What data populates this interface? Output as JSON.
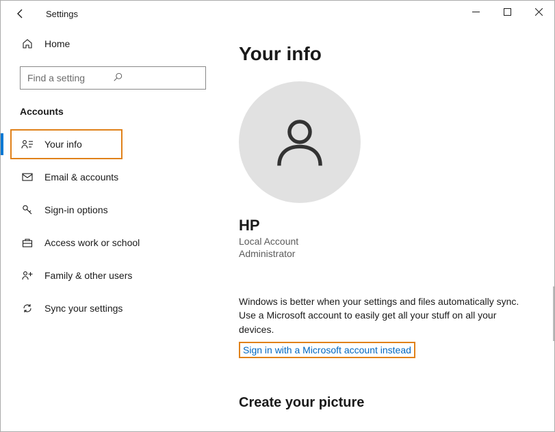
{
  "window": {
    "title": "Settings"
  },
  "sidebar": {
    "home_label": "Home",
    "search_placeholder": "Find a setting",
    "section_header": "Accounts",
    "items": [
      {
        "key": "your-info",
        "label": "Your info"
      },
      {
        "key": "email-accounts",
        "label": "Email & accounts"
      },
      {
        "key": "sign-in-options",
        "label": "Sign-in options"
      },
      {
        "key": "access-work-school",
        "label": "Access work or school"
      },
      {
        "key": "family-other-users",
        "label": "Family & other users"
      },
      {
        "key": "sync-settings",
        "label": "Sync your settings"
      }
    ]
  },
  "main": {
    "title": "Your info",
    "username": "HP",
    "account_type": "Local Account",
    "role": "Administrator",
    "promo_text": "Windows is better when your settings and files automatically sync. Use a Microsoft account to easily get all your stuff on all your devices.",
    "signin_link": "Sign in with a Microsoft account instead",
    "create_picture_header": "Create your picture"
  }
}
